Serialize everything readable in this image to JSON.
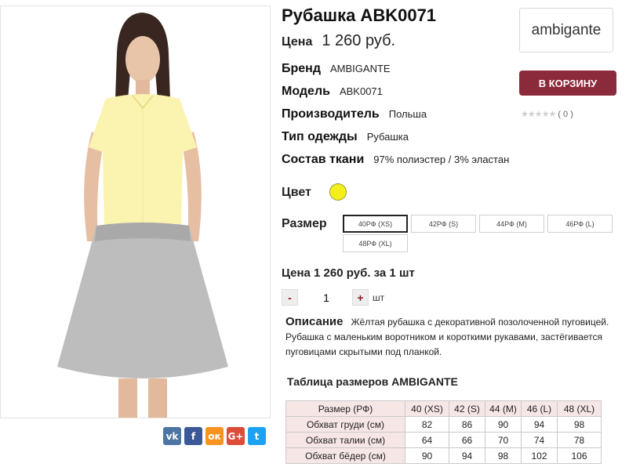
{
  "product": {
    "title": "Рубашка ABK0071",
    "price_label": "Цена",
    "price_value": "1 260 руб."
  },
  "brand_logo": "ambigante",
  "specs": [
    {
      "label": "Бренд",
      "value": "AMBIGANTE"
    },
    {
      "label": "Модель",
      "value": "ABK0071"
    },
    {
      "label": "Производитель",
      "value": "Польша"
    },
    {
      "label": "Тип одежды",
      "value": "Рубашка"
    },
    {
      "label": "Состав ткани",
      "value": "97% полиэстер / 3% эластан"
    }
  ],
  "cart_button": "В КОРЗИНУ",
  "rating": {
    "stars": "★★★★★",
    "count": "( 0 )",
    "value": 0
  },
  "color": {
    "label": "Цвет",
    "swatch": "#f3ee1c"
  },
  "size": {
    "label": "Размер",
    "options": [
      "40РФ (XS)",
      "42РФ (S)",
      "44РФ (M)",
      "46РФ (L)",
      "48РФ (XL)"
    ],
    "selected": "40РФ (XS)"
  },
  "unit_price": "Цена 1 260 руб. за 1 шт",
  "quantity": {
    "minus": "-",
    "value": "1",
    "plus": "+",
    "unit": "шт"
  },
  "description": {
    "label": "Описание",
    "text": "Жёлтая рубашка с декоративной позолоченной пуговицей. Рубашка с маленьким воротником и короткими рукавами, застёгивается пуговицами скрытыми под планкой."
  },
  "size_table": {
    "title": "Таблица размеров AMBIGANTE",
    "headers": [
      "Размер (РФ)",
      "40 (XS)",
      "42 (S)",
      "44 (M)",
      "46 (L)",
      "48 (XL)"
    ],
    "rows": [
      [
        "Обхват груди (см)",
        "82",
        "86",
        "90",
        "94",
        "98"
      ],
      [
        "Обхват талии (см)",
        "64",
        "66",
        "70",
        "74",
        "78"
      ],
      [
        "Обхват бёдер (см)",
        "90",
        "94",
        "98",
        "102",
        "106"
      ]
    ]
  },
  "share": {
    "icons": [
      "vk-icon",
      "facebook-icon",
      "odnoklassniki-icon",
      "google-plus-icon",
      "twitter-icon"
    ],
    "glyphs": [
      "vk",
      "f",
      "ок",
      "G+",
      "t"
    ],
    "colors": [
      "#4c75a3",
      "#3b5998",
      "#f7931e",
      "#dd4b39",
      "#1da1f2"
    ]
  }
}
